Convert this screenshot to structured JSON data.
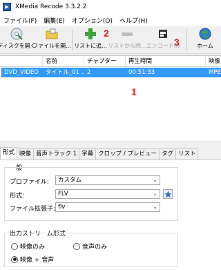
{
  "window": {
    "title": "XMedia Recode 3.3.2.2"
  },
  "menu": [
    {
      "label": "ファイル(F)"
    },
    {
      "label": "編集(E)"
    },
    {
      "label": "オプション(O)"
    },
    {
      "label": "ヘルプ(H)"
    }
  ],
  "toolbar": {
    "open_disc": "ディスクを開く",
    "open_file": "ファイルを開...",
    "add_list": "リストに追...",
    "remove_list": "リストから除...",
    "encode": "エンコード(I)",
    "home": "ホーム"
  },
  "annotations": {
    "a1": "1",
    "a2": "2",
    "a3": "3"
  },
  "grid": {
    "columns": [
      "",
      "名前",
      "チャプター",
      "再生時間",
      "映像"
    ],
    "row": {
      "source": "DVD_VIDEO",
      "name": "タイトル_01 ...",
      "chapter": "2",
      "duration": "00:51:33",
      "video": "MPEG"
    }
  },
  "tabs": [
    "形式",
    "映像",
    "音声トラック 1",
    "字幕",
    "クロップ / プレビュー",
    "タグ",
    "リスト"
  ],
  "format_panel": {
    "general_label": "一般",
    "profile_label": "プロファイル:",
    "profile_value": "カスタム",
    "format_label": "形式:",
    "format_value": "FLV",
    "ext_label": "ファイル拡張子:",
    "ext_value": "flv",
    "output_label": "出力ストリーム形式",
    "video_only": "映像のみ",
    "audio_only": "音声のみ",
    "video_audio": "映像 + 音声"
  },
  "colors": {
    "selection": "#3399ff",
    "annotation": "#e02020"
  }
}
